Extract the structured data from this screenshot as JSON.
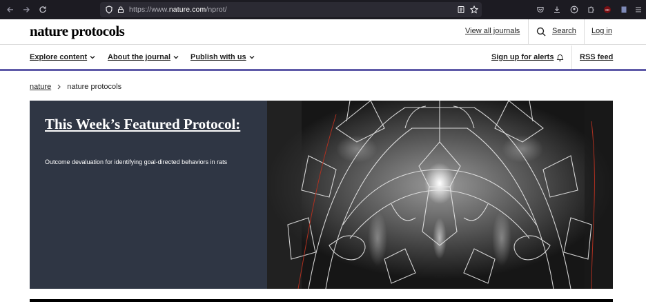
{
  "browser": {
    "url_prefix": "https://www.",
    "url_host": "nature.com",
    "url_path": "/nprot/",
    "icons": [
      "back-icon",
      "forward-icon",
      "reload-icon",
      "shield-icon",
      "lock-icon",
      "reader-icon",
      "star-icon",
      "pocket-icon",
      "download-icon",
      "account-icon",
      "extensions-icon",
      "ublock-icon",
      "page-icon",
      "menu-icon"
    ]
  },
  "header": {
    "logo": "nature protocols",
    "view_all_journals": "View all journals",
    "search": "Search",
    "login": "Log in"
  },
  "subnav": {
    "explore": "Explore content",
    "about": "About the journal",
    "publish": "Publish with us",
    "alerts": "Sign up for alerts",
    "rss": "RSS feed",
    "accent_color": "#5e5aa8"
  },
  "breadcrumb": {
    "root": "nature",
    "current": "nature protocols"
  },
  "hero": {
    "title": "This Week’s Featured Protocol:",
    "subtitle": "Outcome devaluation for identifying goal-directed behaviors in rats",
    "panel_color": "#2f3644"
  }
}
